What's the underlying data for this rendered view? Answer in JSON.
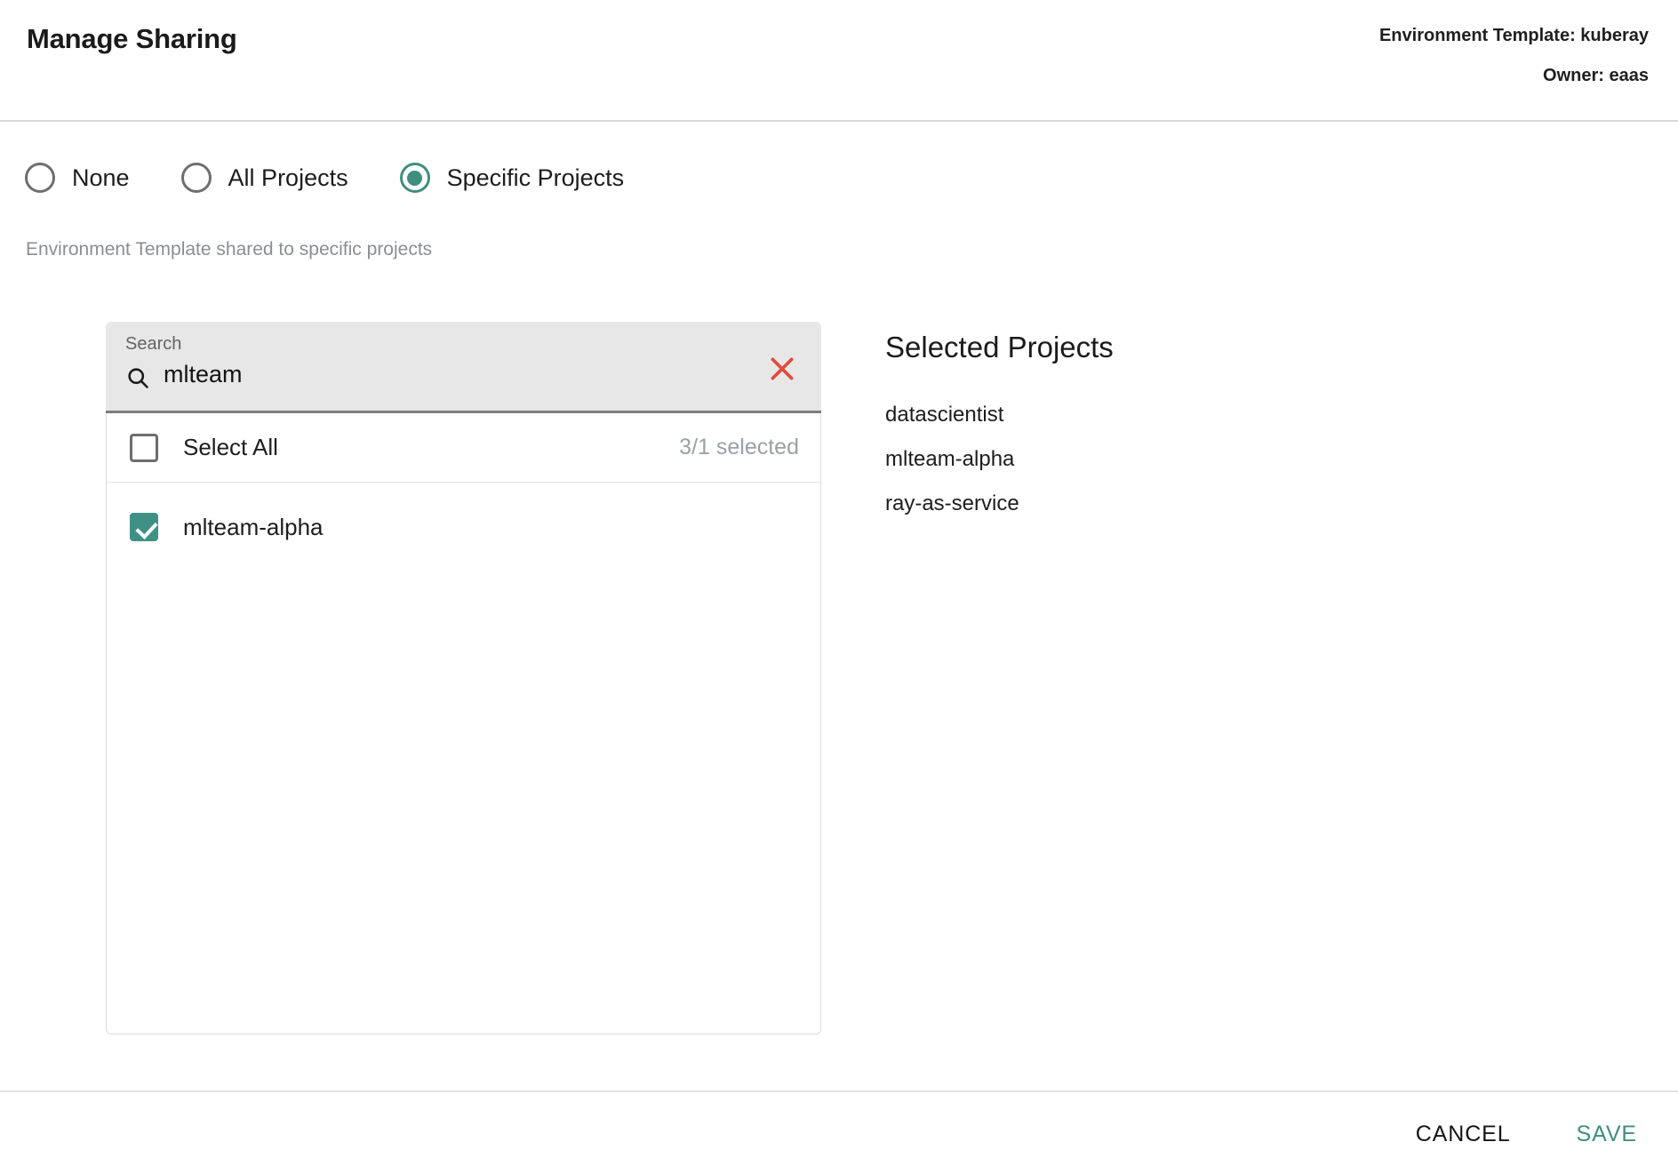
{
  "header": {
    "title": "Manage Sharing",
    "template_line": "Environment Template: kuberay",
    "owner_line": "Owner: eaas"
  },
  "sharing_scope": {
    "options": [
      {
        "label": "None",
        "selected": false
      },
      {
        "label": "All Projects",
        "selected": false
      },
      {
        "label": "Specific Projects",
        "selected": true
      }
    ],
    "helper_text": "Environment Template shared to specific projects"
  },
  "search": {
    "label": "Search",
    "value": "mlteam",
    "placeholder": "Search",
    "clear_icon": "close-icon",
    "search_icon": "search-icon"
  },
  "project_list": {
    "select_all_label": "Select All",
    "select_all_checked": false,
    "count_label": "3/1 selected",
    "items": [
      {
        "label": "mlteam-alpha",
        "checked": true
      }
    ]
  },
  "selected_projects": {
    "title": "Selected Projects",
    "items": [
      "datascientist",
      "mlteam-alpha",
      "ray-as-service"
    ]
  },
  "footer": {
    "cancel_label": "CANCEL",
    "save_label": "SAVE"
  },
  "colors": {
    "accent_teal": "#3f8f80",
    "checkbox_teal": "#3f9185",
    "clear_red": "#e04b3a",
    "muted_gray": "#9aa0a6"
  }
}
